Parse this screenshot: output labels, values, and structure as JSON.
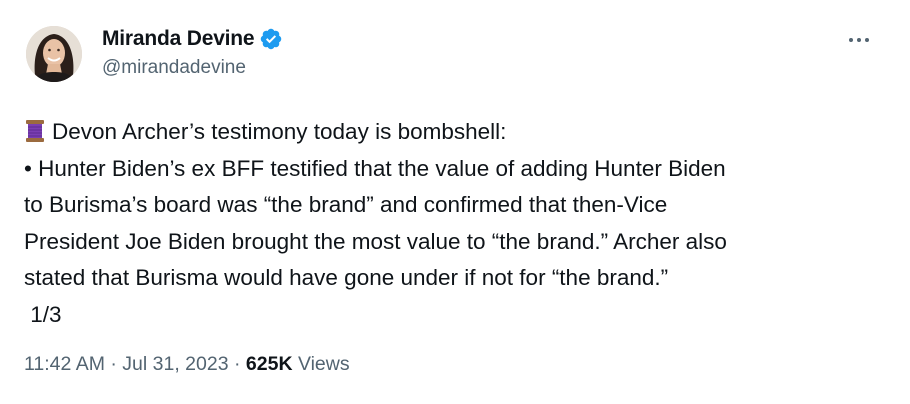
{
  "author": {
    "display_name": "Miranda Devine",
    "handle": "@mirandadevine",
    "verified": true
  },
  "icons": {
    "avatar": "profile-photo",
    "verified": "verified-badge-icon",
    "more": "more-options-icon",
    "emoji": "spool-of-thread-emoji"
  },
  "colors": {
    "verified_blue": "#1d9bf0",
    "secondary_text": "#536471",
    "primary_text": "#0f1419"
  },
  "tweet": {
    "lines": [
      "Devon Archer’s testimony today is bombshell:",
      "• Hunter Biden’s ex BFF testified that the value of adding Hunter Biden",
      "to Burisma’s board was “the brand” and confirmed that then-Vice",
      "President Joe Biden brought the most value to “the brand.” Archer also",
      "stated that Burisma would have gone under if not for “the brand.”",
      " 1/3"
    ]
  },
  "meta": {
    "time": "11:42 AM",
    "separator": " · ",
    "date": "Jul 31, 2023",
    "views_count": "625K",
    "views_label": " Views"
  }
}
